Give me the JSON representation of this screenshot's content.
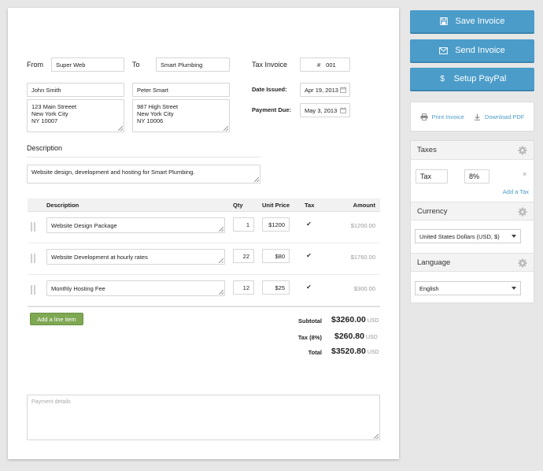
{
  "invoice": {
    "from_label": "From",
    "from_company": "Super Web",
    "to_label": "To",
    "to_company": "Smart Plumbing",
    "from_name": "John Smith",
    "to_name": "Peter Smart",
    "from_address": "123 Main Streeet\nNew York City\nNY 10007",
    "to_address": "987 High Street\nNew York City\nNY 10006",
    "tax_invoice_label": "Tax Invoice",
    "number_symbol": "#",
    "number": "001",
    "date_issued_label": "Date Issued:",
    "date_issued": "Apr 19, 2013",
    "payment_due_label": "Payment Due:",
    "payment_due": "May 3, 2013",
    "description_label": "Description",
    "description": "Website design, development and hosting for Smart Plumbing."
  },
  "table": {
    "headers": {
      "description": "Description",
      "qty": "Qty",
      "unit_price": "Unit Price",
      "tax": "Tax",
      "amount": "Amount"
    },
    "rows": [
      {
        "description": "Website Design Package",
        "qty": "1",
        "unit_price": "$1200",
        "tax": true,
        "amount": "$1200.00"
      },
      {
        "description": "Website Development at hourly rates",
        "qty": "22",
        "unit_price": "$80",
        "tax": true,
        "amount": "$1760.00"
      },
      {
        "description": "Monthly Hosting Fee",
        "qty": "12",
        "unit_price": "$25",
        "tax": true,
        "amount": "$300.00"
      }
    ],
    "add_line_item": "Add a line item"
  },
  "totals": {
    "subtotal_label": "Subtotal",
    "subtotal": "$3260.00",
    "tax_label": "Tax (8%)",
    "tax": "$260.80",
    "total_label": "Total",
    "total": "$3520.80",
    "currency_code": "USD"
  },
  "payment_details_placeholder": "Payment details",
  "sidebar": {
    "save_label": "Save Invoice",
    "send_label": "Send Invoice",
    "paypal_label": "Setup PayPal",
    "paypal_symbol": "$",
    "print_label": "Print Invoice",
    "download_label": "Download PDF",
    "taxes_title": "Taxes",
    "tax_name": "Tax",
    "tax_rate": "8%",
    "remove_symbol": "×",
    "add_tax": "Add a Tax",
    "currency_title": "Currency",
    "currency_value": "United States Dollars (USD, $)",
    "language_title": "Language",
    "language_value": "English"
  },
  "colors": {
    "accent": "#4b9cc9",
    "green_button": "#7fa853",
    "background": "#e7e7e7"
  },
  "icons": [
    "save-icon",
    "envelope-icon",
    "dollar-icon",
    "printer-icon",
    "download-icon",
    "gear-icon",
    "calendar-icon",
    "resize-handle-icon",
    "drag-handle-icon",
    "close-icon"
  ]
}
